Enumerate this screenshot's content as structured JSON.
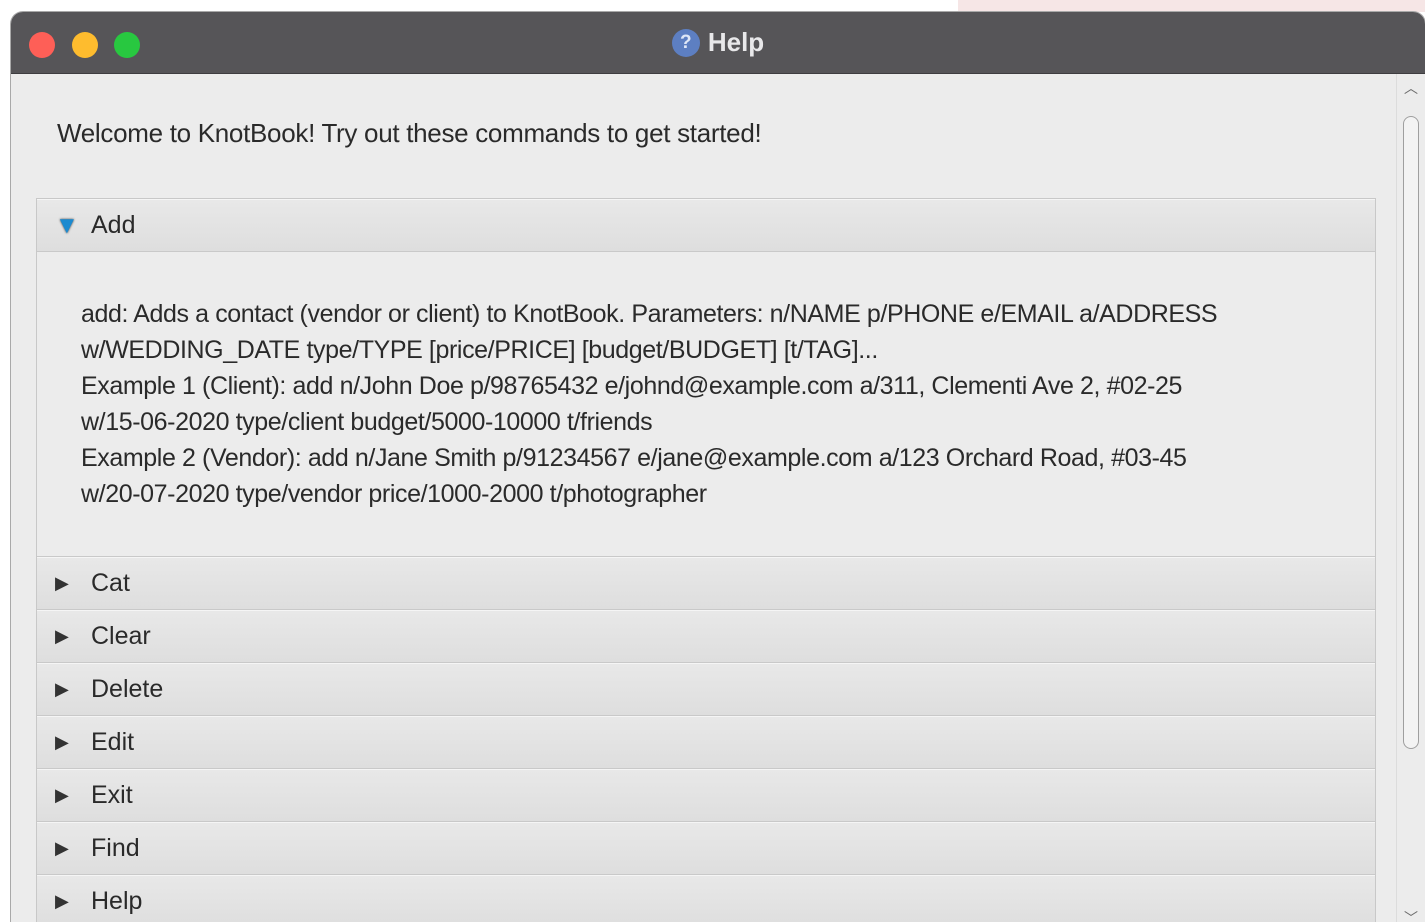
{
  "window": {
    "title": "Help",
    "help_icon_glyph": "?"
  },
  "welcome_text": "Welcome to KnotBook! Try out these commands to get started!",
  "commands": {
    "add": {
      "label": "Add",
      "expanded": true,
      "lines": [
        "add: Adds a contact (vendor or client) to KnotBook. Parameters: n/NAME p/PHONE e/EMAIL a/ADDRESS",
        "w/WEDDING_DATE type/TYPE [price/PRICE] [budget/BUDGET] [t/TAG]...",
        "Example 1 (Client): add n/John Doe p/98765432 e/johnd@example.com a/311, Clementi Ave 2, #02-25",
        "w/15-06-2020 type/client budget/5000-10000 t/friends",
        "Example 2 (Vendor): add n/Jane Smith p/91234567 e/jane@example.com a/123 Orchard Road, #03-45",
        "w/20-07-2020 type/vendor price/1000-2000 t/photographer"
      ]
    },
    "collapsed": [
      {
        "label": "Cat"
      },
      {
        "label": "Clear"
      },
      {
        "label": "Delete"
      },
      {
        "label": "Edit"
      },
      {
        "label": "Exit"
      },
      {
        "label": "Find"
      },
      {
        "label": "Help"
      }
    ]
  },
  "icons": {
    "expanded_arrow": "▼",
    "collapsed_arrow": "▶",
    "scroll_up": "︿",
    "scroll_down": "﹀"
  },
  "colors": {
    "titlebar": "#565558",
    "close": "#fe5f57",
    "minimize": "#febc2e",
    "zoom": "#28c840",
    "accent_arrow": "#1b8ad0"
  }
}
